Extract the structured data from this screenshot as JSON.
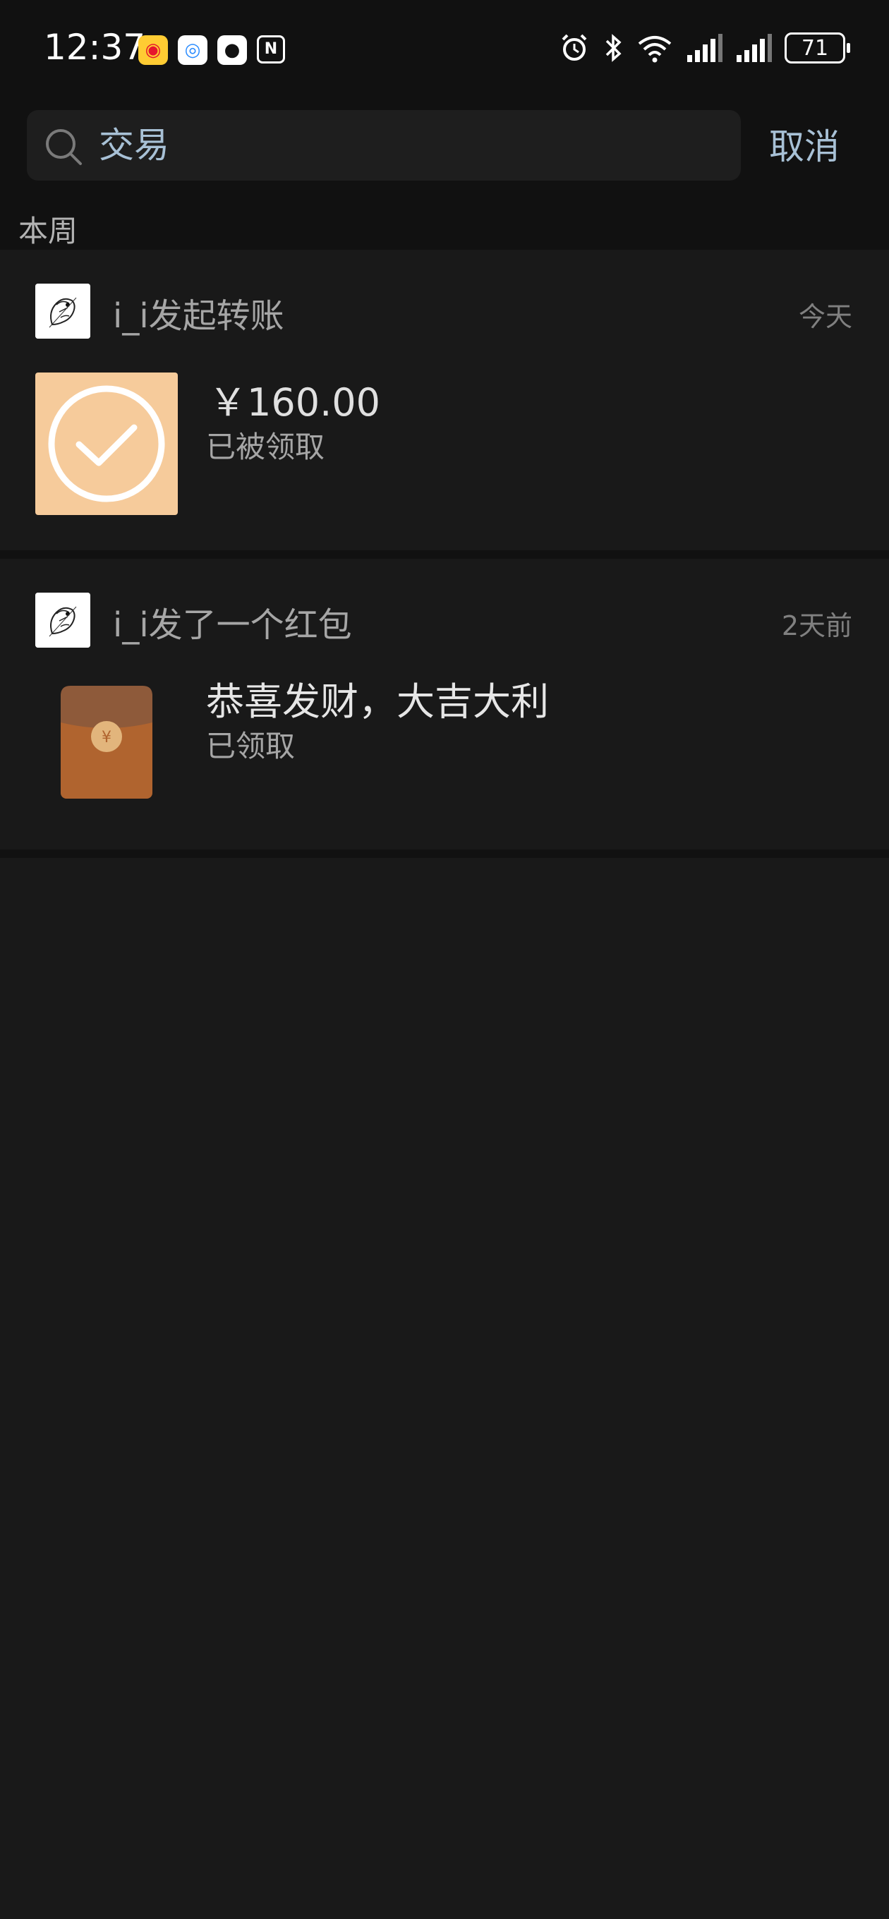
{
  "status_bar": {
    "time": "12:37",
    "battery": "71",
    "app_icons": [
      "weibo-icon",
      "browser-icon",
      "qq-icon",
      "nfc-icon"
    ],
    "system_icons": [
      "alarm-icon",
      "bluetooth-icon",
      "wifi-icon",
      "signal-icon",
      "signal-icon"
    ]
  },
  "search": {
    "value": "交易",
    "cancel_label": "取消"
  },
  "section": {
    "label": "本周"
  },
  "records": [
    {
      "title": "i_i发起转账",
      "time": "今天",
      "amount": "￥160.00",
      "status": "已被领取"
    },
    {
      "title": "i_i发了一个红包",
      "time": "2天前",
      "blessing": "恭喜发财，大吉大利",
      "status": "已领取"
    }
  ],
  "colors": {
    "background": "#191919",
    "header_background": "#111111",
    "accent": "#a8c1d6",
    "transfer_thumb": "#f6cb9b",
    "red_envelope": "#b0642f"
  }
}
